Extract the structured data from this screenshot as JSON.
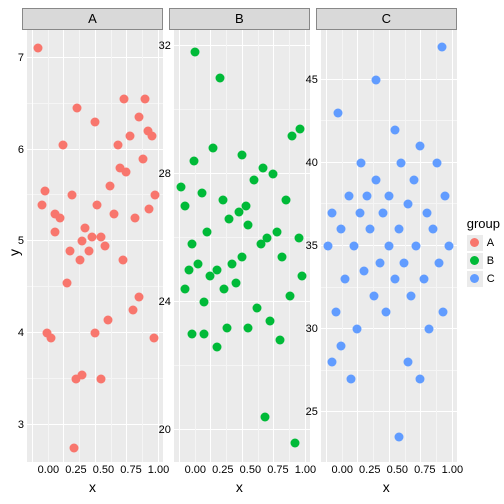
{
  "chart_data": {
    "type": "scatter",
    "facets": [
      "A",
      "B",
      "C"
    ],
    "xlabel": "x",
    "ylabel": "y",
    "legend_title": "group",
    "legend_items": [
      "A",
      "B",
      "C"
    ],
    "colors": {
      "A": "#F8766D",
      "B": "#00BA38",
      "C": "#619CFF"
    },
    "x_ticks": [
      0.0,
      0.25,
      0.5,
      0.75,
      1.0
    ],
    "panels": [
      {
        "group": "A",
        "ylim": [
          2.6,
          7.3
        ],
        "y_ticks": [
          3,
          4,
          5,
          6,
          7
        ],
        "points": [
          {
            "x": 0.05,
            "y": 7.1
          },
          {
            "x": 0.08,
            "y": 5.4
          },
          {
            "x": 0.1,
            "y": 5.55
          },
          {
            "x": 0.12,
            "y": 4.0
          },
          {
            "x": 0.15,
            "y": 3.95
          },
          {
            "x": 0.18,
            "y": 5.1
          },
          {
            "x": 0.18,
            "y": 5.3
          },
          {
            "x": 0.22,
            "y": 5.25
          },
          {
            "x": 0.25,
            "y": 6.05
          },
          {
            "x": 0.28,
            "y": 4.55
          },
          {
            "x": 0.3,
            "y": 4.9
          },
          {
            "x": 0.32,
            "y": 5.5
          },
          {
            "x": 0.33,
            "y": 2.75
          },
          {
            "x": 0.35,
            "y": 3.5
          },
          {
            "x": 0.36,
            "y": 6.45
          },
          {
            "x": 0.38,
            "y": 4.8
          },
          {
            "x": 0.4,
            "y": 5.0
          },
          {
            "x": 0.4,
            "y": 3.55
          },
          {
            "x": 0.42,
            "y": 5.15
          },
          {
            "x": 0.45,
            "y": 4.9
          },
          {
            "x": 0.48,
            "y": 5.05
          },
          {
            "x": 0.5,
            "y": 4.0
          },
          {
            "x": 0.5,
            "y": 6.3
          },
          {
            "x": 0.52,
            "y": 5.4
          },
          {
            "x": 0.55,
            "y": 5.05
          },
          {
            "x": 0.55,
            "y": 3.5
          },
          {
            "x": 0.58,
            "y": 4.95
          },
          {
            "x": 0.6,
            "y": 4.15
          },
          {
            "x": 0.62,
            "y": 5.6
          },
          {
            "x": 0.65,
            "y": 5.3
          },
          {
            "x": 0.68,
            "y": 6.05
          },
          {
            "x": 0.7,
            "y": 5.8
          },
          {
            "x": 0.72,
            "y": 4.8
          },
          {
            "x": 0.73,
            "y": 6.55
          },
          {
            "x": 0.75,
            "y": 5.75
          },
          {
            "x": 0.78,
            "y": 6.15
          },
          {
            "x": 0.8,
            "y": 4.25
          },
          {
            "x": 0.82,
            "y": 5.25
          },
          {
            "x": 0.85,
            "y": 6.35
          },
          {
            "x": 0.85,
            "y": 4.4
          },
          {
            "x": 0.88,
            "y": 5.9
          },
          {
            "x": 0.9,
            "y": 6.55
          },
          {
            "x": 0.92,
            "y": 6.2
          },
          {
            "x": 0.93,
            "y": 5.35
          },
          {
            "x": 0.95,
            "y": 6.15
          },
          {
            "x": 0.97,
            "y": 3.95
          },
          {
            "x": 0.98,
            "y": 5.5
          }
        ]
      },
      {
        "group": "B",
        "ylim": [
          19.0,
          32.5
        ],
        "y_ticks": [
          20,
          24,
          28,
          32
        ],
        "points": [
          {
            "x": 0.02,
            "y": 27.6
          },
          {
            "x": 0.05,
            "y": 24.4
          },
          {
            "x": 0.05,
            "y": 27.0
          },
          {
            "x": 0.08,
            "y": 25.0
          },
          {
            "x": 0.1,
            "y": 25.8
          },
          {
            "x": 0.1,
            "y": 23.0
          },
          {
            "x": 0.12,
            "y": 28.4
          },
          {
            "x": 0.13,
            "y": 31.8
          },
          {
            "x": 0.15,
            "y": 25.2
          },
          {
            "x": 0.18,
            "y": 27.4
          },
          {
            "x": 0.2,
            "y": 24.0
          },
          {
            "x": 0.2,
            "y": 23.0
          },
          {
            "x": 0.22,
            "y": 26.2
          },
          {
            "x": 0.25,
            "y": 24.8
          },
          {
            "x": 0.27,
            "y": 28.8
          },
          {
            "x": 0.3,
            "y": 22.6
          },
          {
            "x": 0.3,
            "y": 25.0
          },
          {
            "x": 0.33,
            "y": 31.0
          },
          {
            "x": 0.35,
            "y": 27.2
          },
          {
            "x": 0.36,
            "y": 24.4
          },
          {
            "x": 0.38,
            "y": 23.2
          },
          {
            "x": 0.4,
            "y": 26.6
          },
          {
            "x": 0.42,
            "y": 25.2
          },
          {
            "x": 0.45,
            "y": 24.6
          },
          {
            "x": 0.48,
            "y": 26.8
          },
          {
            "x": 0.5,
            "y": 25.4
          },
          {
            "x": 0.5,
            "y": 28.6
          },
          {
            "x": 0.53,
            "y": 27.0
          },
          {
            "x": 0.55,
            "y": 23.2
          },
          {
            "x": 0.55,
            "y": 26.4
          },
          {
            "x": 0.6,
            "y": 27.8
          },
          {
            "x": 0.62,
            "y": 23.8
          },
          {
            "x": 0.65,
            "y": 25.8
          },
          {
            "x": 0.67,
            "y": 28.2
          },
          {
            "x": 0.68,
            "y": 20.4
          },
          {
            "x": 0.7,
            "y": 26.0
          },
          {
            "x": 0.72,
            "y": 23.4
          },
          {
            "x": 0.75,
            "y": 28.0
          },
          {
            "x": 0.78,
            "y": 26.2
          },
          {
            "x": 0.8,
            "y": 22.8
          },
          {
            "x": 0.82,
            "y": 25.4
          },
          {
            "x": 0.85,
            "y": 27.2
          },
          {
            "x": 0.88,
            "y": 24.2
          },
          {
            "x": 0.9,
            "y": 29.2
          },
          {
            "x": 0.92,
            "y": 19.6
          },
          {
            "x": 0.95,
            "y": 26.0
          },
          {
            "x": 0.96,
            "y": 29.4
          },
          {
            "x": 0.98,
            "y": 24.8
          }
        ]
      },
      {
        "group": "C",
        "ylim": [
          22.0,
          48.0
        ],
        "y_ticks": [
          25,
          30,
          35,
          40,
          45
        ],
        "points": [
          {
            "x": 0.02,
            "y": 35.0
          },
          {
            "x": 0.05,
            "y": 28.0
          },
          {
            "x": 0.05,
            "y": 37.0
          },
          {
            "x": 0.08,
            "y": 31.0
          },
          {
            "x": 0.1,
            "y": 43.0
          },
          {
            "x": 0.12,
            "y": 29.0
          },
          {
            "x": 0.12,
            "y": 36.0
          },
          {
            "x": 0.15,
            "y": 33.0
          },
          {
            "x": 0.18,
            "y": 38.0
          },
          {
            "x": 0.2,
            "y": 27.0
          },
          {
            "x": 0.22,
            "y": 35.0
          },
          {
            "x": 0.25,
            "y": 30.0
          },
          {
            "x": 0.27,
            "y": 37.0
          },
          {
            "x": 0.28,
            "y": 40.0
          },
          {
            "x": 0.3,
            "y": 33.5
          },
          {
            "x": 0.33,
            "y": 38.0
          },
          {
            "x": 0.35,
            "y": 36.0
          },
          {
            "x": 0.38,
            "y": 32.0
          },
          {
            "x": 0.4,
            "y": 39.0
          },
          {
            "x": 0.4,
            "y": 45.0
          },
          {
            "x": 0.43,
            "y": 34.0
          },
          {
            "x": 0.45,
            "y": 37.0
          },
          {
            "x": 0.48,
            "y": 31.0
          },
          {
            "x": 0.5,
            "y": 38.0
          },
          {
            "x": 0.5,
            "y": 35.0
          },
          {
            "x": 0.55,
            "y": 33.0
          },
          {
            "x": 0.55,
            "y": 42.0
          },
          {
            "x": 0.58,
            "y": 36.0
          },
          {
            "x": 0.58,
            "y": 23.5
          },
          {
            "x": 0.6,
            "y": 40.0
          },
          {
            "x": 0.62,
            "y": 34.0
          },
          {
            "x": 0.65,
            "y": 37.5
          },
          {
            "x": 0.65,
            "y": 28.0
          },
          {
            "x": 0.68,
            "y": 32.0
          },
          {
            "x": 0.7,
            "y": 39.0
          },
          {
            "x": 0.72,
            "y": 35.0
          },
          {
            "x": 0.75,
            "y": 27.0
          },
          {
            "x": 0.75,
            "y": 41.0
          },
          {
            "x": 0.78,
            "y": 33.0
          },
          {
            "x": 0.8,
            "y": 37.0
          },
          {
            "x": 0.82,
            "y": 30.0
          },
          {
            "x": 0.85,
            "y": 36.0
          },
          {
            "x": 0.88,
            "y": 40.0
          },
          {
            "x": 0.9,
            "y": 34.0
          },
          {
            "x": 0.92,
            "y": 47.0
          },
          {
            "x": 0.93,
            "y": 31.0
          },
          {
            "x": 0.95,
            "y": 38.0
          },
          {
            "x": 0.98,
            "y": 35.0
          }
        ]
      }
    ]
  }
}
